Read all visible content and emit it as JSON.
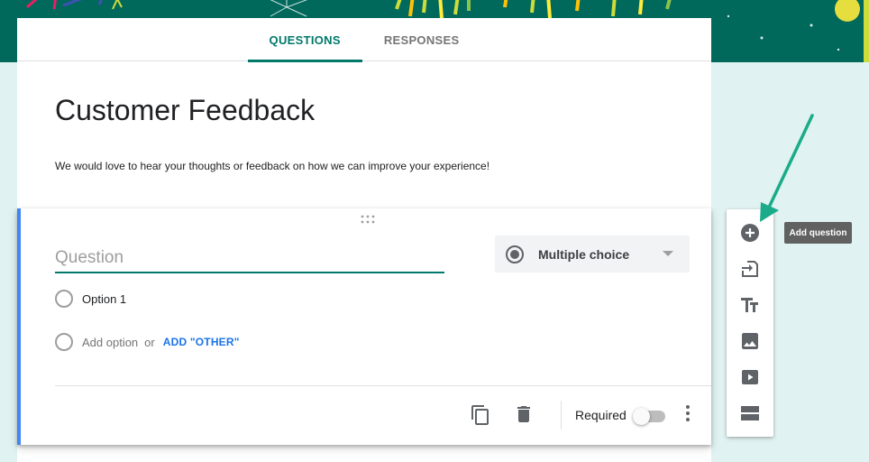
{
  "tabs": {
    "questions": "QUESTIONS",
    "responses": "RESPONSES"
  },
  "form": {
    "title": "Customer Feedback",
    "description": "We would love to hear your thoughts or feedback on how we can improve your experience!"
  },
  "question": {
    "placeholder": "Question",
    "type": "Multiple choice",
    "options": [
      "Option 1"
    ],
    "add_option": "Add option",
    "or": "or",
    "add_other": "ADD \"OTHER\""
  },
  "footer": {
    "required_label": "Required",
    "required": false
  },
  "toolbar": {
    "tooltip": "Add question",
    "items": [
      "add-question-icon",
      "import-questions-icon",
      "title-description-icon",
      "image-icon",
      "video-icon",
      "section-icon"
    ]
  },
  "colors": {
    "accent": "#00796b",
    "banner": "#00695c",
    "background": "#e0f2f1",
    "focus_border": "#4285f4",
    "annotation_arrow": "#1aab8a"
  }
}
